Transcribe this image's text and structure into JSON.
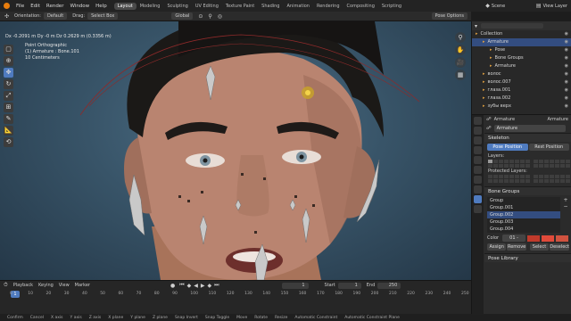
{
  "topbar": {
    "menus": [
      "File",
      "Edit",
      "Render",
      "Window",
      "Help"
    ],
    "workspaces": [
      "Layout",
      "Modeling",
      "Sculpting",
      "UV Editing",
      "Texture Paint",
      "Shading",
      "Animation",
      "Rendering",
      "Compositing",
      "Scripting"
    ],
    "scene_label": "Scene",
    "view_layer_label": "View Layer"
  },
  "header": {
    "orientation_label": "Orientation:",
    "orientation_value": "Default",
    "drag_label": "Drag:",
    "drag_value": "Select Box",
    "transform_value": "Global",
    "pose_options": "Pose Options"
  },
  "viewport": {
    "dims": "Dx -0.2091 m  Dy -0 m  Dz 0.2629 m (0.3356 m)",
    "view_name": "Point Orthographic",
    "object_info": "(1) Armature : Bone.101",
    "scale_info": "10 Centimeters"
  },
  "timeline": {
    "menus": [
      "Playback",
      "Keying",
      "View",
      "Marker"
    ],
    "current_frame": "1",
    "start_label": "Start",
    "start_value": "1",
    "end_label": "End",
    "end_value": "250",
    "ticks": [
      "0",
      "10",
      "20",
      "30",
      "40",
      "50",
      "60",
      "70",
      "80",
      "90",
      "100",
      "110",
      "120",
      "130",
      "140",
      "150",
      "160",
      "170",
      "180",
      "190",
      "200",
      "210",
      "220",
      "230",
      "240",
      "250"
    ]
  },
  "statusbar": {
    "items": [
      "Confirm",
      "Cancel",
      "X axis",
      "Y axis",
      "Z axis",
      "X plane",
      "Y plane",
      "Z plane",
      "Snap Invert",
      "Snap Toggle",
      "Move",
      "Rotate",
      "Resize",
      "Automatic Constraint",
      "Automatic Constraint Plane"
    ]
  },
  "outliner": {
    "rows": [
      {
        "label": "Collection",
        "indent": 0,
        "selected": false
      },
      {
        "label": "Armature",
        "indent": 1,
        "selected": true
      },
      {
        "label": "Pose",
        "indent": 2,
        "selected": false
      },
      {
        "label": "Bone Groups",
        "indent": 2,
        "selected": false
      },
      {
        "label": "Armature",
        "indent": 2,
        "selected": false
      },
      {
        "label": "волос",
        "indent": 1,
        "selected": false
      },
      {
        "label": "волос.007",
        "indent": 1,
        "selected": false
      },
      {
        "label": "глаза.001",
        "indent": 1,
        "selected": false
      },
      {
        "label": "глаза.002",
        "indent": 1,
        "selected": false
      },
      {
        "label": "зубы верх",
        "indent": 1,
        "selected": false
      }
    ]
  },
  "properties": {
    "breadcrumb": "Armature",
    "breadcrumb_right": "Armature",
    "data_name": "Armature",
    "skeleton_header": "Skeleton",
    "pose_position": "Pose Position",
    "rest_position": "Rest Position",
    "layers_label": "Layers:",
    "protected_layers_label": "Protected Layers:",
    "bone_groups_header": "Bone Groups",
    "groups": [
      "Group",
      "Group.001",
      "Group.002",
      "Group.003",
      "Group.004"
    ],
    "selected_group_index": 2,
    "color_label": "Color",
    "color_value": "01 -",
    "assign": "Assign",
    "remove": "Remove",
    "select": "Select",
    "deselect": "Deselect",
    "pose_library_header": "Pose Library",
    "accent": "#4f7bbf",
    "color_swatches": [
      "#c03a2b",
      "#e04a3a",
      "#d0523f"
    ]
  }
}
